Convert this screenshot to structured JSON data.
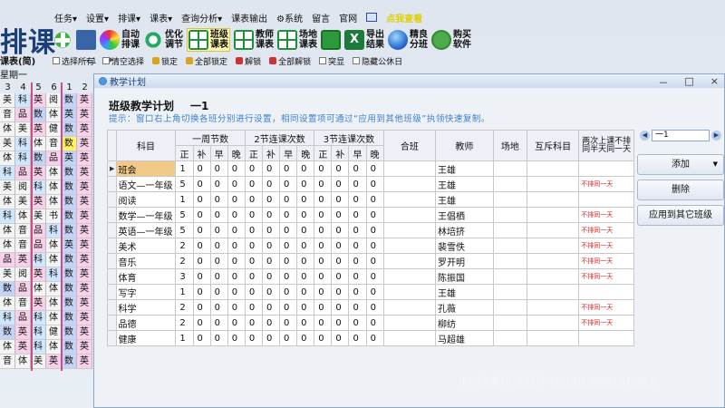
{
  "app": {
    "title": "排课"
  },
  "menu": {
    "items": [
      "任务▾",
      "设置▾",
      "排课▾",
      "课表▾",
      "查询分析▾",
      "课表输出",
      "⚙系统",
      "留言",
      "官网"
    ],
    "blink_text": "点我查看"
  },
  "toolbar": {
    "buttons": [
      {
        "label": "",
        "icon": "add-icon"
      },
      {
        "label": "",
        "icon": "edit-icon"
      },
      {
        "label": "自动\n排课",
        "icon": "auto-schedule-icon"
      },
      {
        "label": "优化\n调节",
        "icon": "optimize-icon"
      },
      {
        "label": "班级\n课表",
        "icon": "class-schedule-icon"
      },
      {
        "label": "教师\n课表",
        "icon": "teacher-schedule-icon"
      },
      {
        "label": "场地\n课表",
        "icon": "venue-schedule-icon"
      },
      {
        "label": "",
        "icon": "save-icon"
      },
      {
        "label": "导出\n结果",
        "icon": "export-icon"
      },
      {
        "label": "精良\n分班",
        "icon": "grouping-icon"
      },
      {
        "label": "购买\n软件",
        "icon": "buy-icon"
      }
    ]
  },
  "actions": [
    "选择所有",
    "清空选择",
    "锁定",
    "全部锁定",
    "解锁",
    "全部解锁",
    "突显",
    "隐藏公休日"
  ],
  "left_panel": {
    "class_select": "课表(简)",
    "class_value": "一1",
    "day": "星期一",
    "periods": [
      "3",
      "4",
      "5",
      "6",
      "1",
      "2"
    ],
    "rows": [
      [
        "美",
        "科",
        "英",
        "阅",
        "数",
        "英"
      ],
      [
        "音",
        "品",
        "数",
        "体",
        "英",
        "英"
      ],
      [
        "体",
        "美",
        "英",
        "健",
        "数",
        "英"
      ],
      [
        "美",
        "科",
        "体",
        "音",
        "数",
        "英"
      ],
      [
        "体",
        "科",
        "数",
        "品",
        "英",
        "英"
      ],
      [
        "科",
        "品",
        "英",
        "体",
        "数",
        "英"
      ],
      [
        "美",
        "阅",
        "科",
        "体",
        "数",
        "英"
      ],
      [
        "体",
        "美",
        "英",
        "体",
        "数",
        "英"
      ],
      [
        "科",
        "体",
        "美",
        "书",
        "数",
        "英"
      ],
      [
        "体",
        "音",
        "品",
        "科",
        "数",
        "英"
      ],
      [
        "体",
        "音",
        "品",
        "体",
        "英",
        "英"
      ],
      [
        "品",
        "英",
        "科",
        "体",
        "数",
        "英"
      ],
      [
        "美",
        "阅",
        "英",
        "科",
        "数",
        "英"
      ],
      [
        "数",
        "品",
        "体",
        "体",
        "数",
        "英"
      ],
      [
        "体",
        "音",
        "英",
        "体",
        "数",
        "英"
      ],
      [
        "科",
        "品",
        "科",
        "体",
        "数",
        "英"
      ],
      [
        "数",
        "英",
        "科",
        "健",
        "数",
        "英"
      ],
      [
        "体",
        "英",
        "科",
        "体",
        "数",
        "英"
      ],
      [
        "音",
        "体",
        "美",
        "英",
        "数",
        "英"
      ]
    ]
  },
  "dialog": {
    "title": "教学计划",
    "heading": "班级教学计划",
    "class_name": "一1",
    "hint": "提示：窗口右上角切换各班分别进行设置，相同设置项可通过“应用到其他班级”执领快速复制。",
    "controls": [
      "－",
      "□",
      "×"
    ],
    "table": {
      "group_headers": [
        "科目",
        "一周节数",
        "2节连课次数",
        "3节连课次数",
        "合班",
        "教师",
        "场地",
        "互斥科目",
        "两次上课不排同半天同一天"
      ],
      "sub_headers": [
        "正",
        "补",
        "早",
        "晚",
        "正",
        "补",
        "早",
        "晚",
        "正",
        "补",
        "早",
        "晚"
      ],
      "rows": [
        {
          "subject": "班会",
          "vals": [
            "1",
            "0",
            "0",
            "0",
            "0",
            "0",
            "0",
            "0",
            "0",
            "0",
            "0",
            "0"
          ],
          "teacher": "王雄",
          "conflict": ""
        },
        {
          "subject": "语文—一年级",
          "vals": [
            "5",
            "0",
            "0",
            "0",
            "0",
            "0",
            "0",
            "0",
            "0",
            "0",
            "0",
            "0"
          ],
          "teacher": "王雄",
          "conflict": "不排同一天"
        },
        {
          "subject": "阅读",
          "vals": [
            "1",
            "0",
            "0",
            "0",
            "0",
            "0",
            "0",
            "0",
            "0",
            "0",
            "0",
            "0"
          ],
          "teacher": "王雄",
          "conflict": ""
        },
        {
          "subject": "数学—一年级",
          "vals": [
            "5",
            "0",
            "0",
            "0",
            "0",
            "0",
            "0",
            "0",
            "0",
            "0",
            "0",
            "0"
          ],
          "teacher": "王倡栖",
          "conflict": "不排同一天"
        },
        {
          "subject": "英语—一年级",
          "vals": [
            "5",
            "0",
            "0",
            "0",
            "0",
            "0",
            "0",
            "0",
            "0",
            "0",
            "0",
            "0"
          ],
          "teacher": "林培挤",
          "conflict": "不排同一天"
        },
        {
          "subject": "美术",
          "vals": [
            "2",
            "0",
            "0",
            "0",
            "0",
            "0",
            "0",
            "0",
            "0",
            "0",
            "0",
            "0"
          ],
          "teacher": "裴雪佚",
          "conflict": "不排同一天"
        },
        {
          "subject": "音乐",
          "vals": [
            "2",
            "0",
            "0",
            "0",
            "0",
            "0",
            "0",
            "0",
            "0",
            "0",
            "0",
            "0"
          ],
          "teacher": "罗开明",
          "conflict": "不排同一天"
        },
        {
          "subject": "体育",
          "vals": [
            "3",
            "0",
            "0",
            "0",
            "0",
            "0",
            "0",
            "0",
            "0",
            "0",
            "0",
            "0"
          ],
          "teacher": "陈振国",
          "conflict": "不排同一天"
        },
        {
          "subject": "写字",
          "vals": [
            "1",
            "0",
            "0",
            "0",
            "0",
            "0",
            "0",
            "0",
            "0",
            "0",
            "0",
            "0"
          ],
          "teacher": "王雄",
          "conflict": ""
        },
        {
          "subject": "科学",
          "vals": [
            "2",
            "0",
            "0",
            "0",
            "0",
            "0",
            "0",
            "0",
            "0",
            "0",
            "0",
            "0"
          ],
          "teacher": "孔薇",
          "conflict": "不排同一天"
        },
        {
          "subject": "品德",
          "vals": [
            "2",
            "0",
            "0",
            "0",
            "0",
            "0",
            "0",
            "0",
            "0",
            "0",
            "0",
            "0"
          ],
          "teacher": "柳纺",
          "conflict": "不排同一天"
        },
        {
          "subject": "健康",
          "vals": [
            "1",
            "0",
            "0",
            "0",
            "0",
            "0",
            "0",
            "0",
            "0",
            "0",
            "0",
            "0"
          ],
          "teacher": "马超雄",
          "conflict": ""
        }
      ]
    },
    "side": {
      "class_value": "一1",
      "add_label": "添加",
      "delete_label": "删除",
      "apply_label": "应用到其它班级"
    }
  },
  "watermark": "jPK精良排课软件45039.869190983"
}
